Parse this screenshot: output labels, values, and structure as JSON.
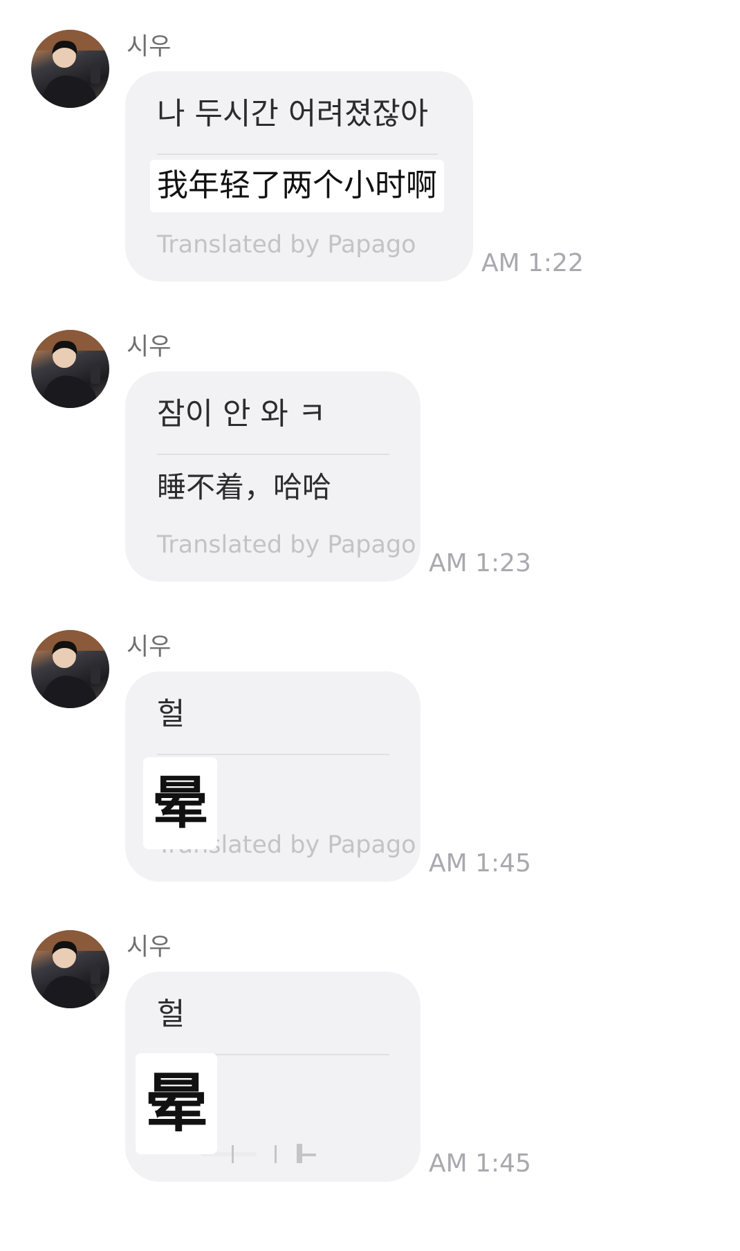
{
  "messages": [
    {
      "sender": "시우",
      "original": "나 두시간 어려졌잖아",
      "translation": "我年轻了两个小时啊",
      "credit": "Translated by Papago",
      "time": "AM 1:22"
    },
    {
      "sender": "시우",
      "original": "잠이 안 와 ㅋ",
      "translation": "睡不着，哈哈",
      "credit": "Translated by Papago",
      "time": "AM 1:23"
    },
    {
      "sender": "시우",
      "original": "헐",
      "overlay": "晕",
      "credit": "Translated by Papago",
      "time": "AM 1:45"
    },
    {
      "sender": "시우",
      "original": "헐",
      "overlay": "晕",
      "time": "AM 1:45"
    }
  ],
  "icons": {
    "avatar": "profile-photo"
  },
  "colors": {
    "bubble": "#f2f2f4",
    "timestamp": "#a8a8ae",
    "credit": "#c3c3c7"
  }
}
